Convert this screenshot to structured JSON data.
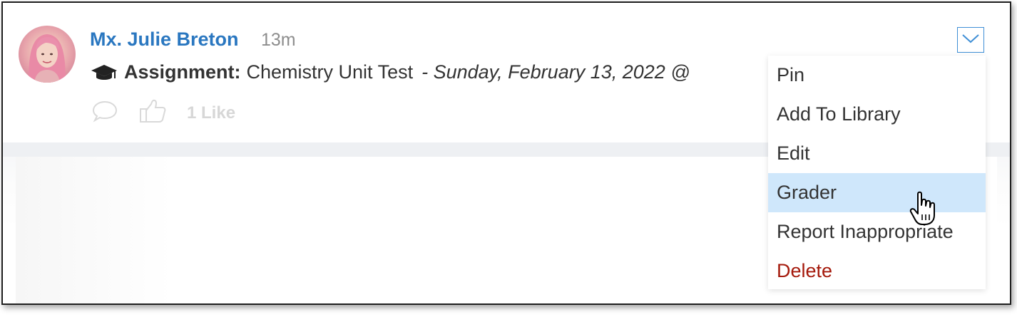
{
  "post": {
    "author": "Mx. Julie Breton",
    "time": "13m",
    "assignment_label": "Assignment:",
    "assignment_title": "Chemistry Unit Test",
    "assignment_date": "- Sunday, February 13, 2022 @",
    "like_count": "1 Like"
  },
  "icons": {
    "assignment": "graduation-cap-icon",
    "comment": "comment-bubble-icon",
    "like": "thumbs-up-icon",
    "toggle": "chevron-down-icon",
    "cursor": "hand-pointer-cursor"
  },
  "menu": {
    "items": [
      {
        "label": "Pin"
      },
      {
        "label": "Add To Library"
      },
      {
        "label": "Edit"
      },
      {
        "label": "Grader"
      },
      {
        "label": "Report Inappropriate"
      },
      {
        "label": "Delete"
      }
    ],
    "hovered": "Grader"
  },
  "colors": {
    "author": "#2a77c0",
    "hover_bg": "#cfe7fb",
    "delete": "#a51a0c",
    "toggle_border": "#3f8fd6"
  }
}
